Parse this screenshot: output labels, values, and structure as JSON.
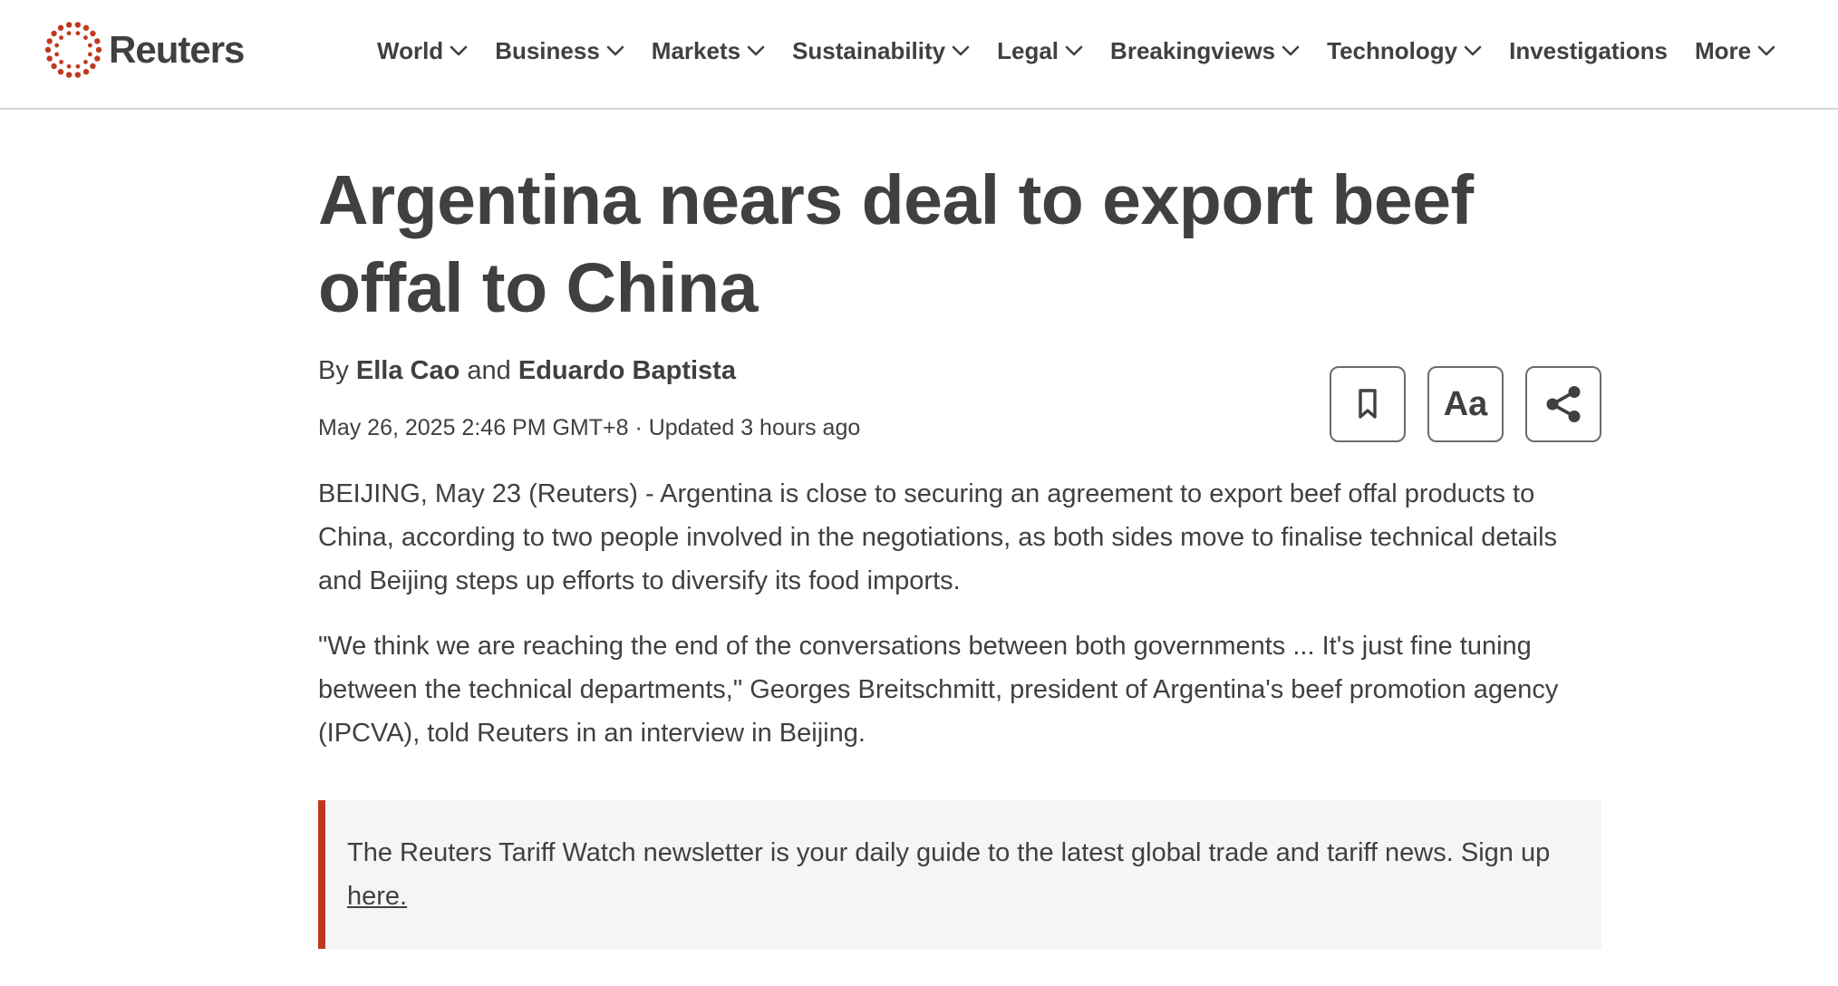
{
  "brand": {
    "name": "Reuters",
    "logo_icon": "reuters-dot-ring-icon",
    "accent_color": "#c0391e"
  },
  "nav": {
    "items": [
      {
        "label": "World",
        "has_dropdown": true
      },
      {
        "label": "Business",
        "has_dropdown": true
      },
      {
        "label": "Markets",
        "has_dropdown": true
      },
      {
        "label": "Sustainability",
        "has_dropdown": true
      },
      {
        "label": "Legal",
        "has_dropdown": true
      },
      {
        "label": "Breakingviews",
        "has_dropdown": true
      },
      {
        "label": "Technology",
        "has_dropdown": true
      },
      {
        "label": "Investigations",
        "has_dropdown": false
      },
      {
        "label": "More",
        "has_dropdown": true
      }
    ]
  },
  "article": {
    "headline": "Argentina nears deal to export beef offal to China",
    "byline": {
      "prefix": "By",
      "author1": "Ella Cao",
      "conjunction": "and",
      "author2": "Eduardo Baptista"
    },
    "dateline": "May 26, 2025 2:46 PM GMT+8 · Updated 3 hours ago",
    "tools": {
      "bookmark_icon": "bookmark-icon",
      "text_size_label": "Aa",
      "share_icon": "share-icon"
    },
    "paragraphs": [
      "BEIJING, May 23 (Reuters) - Argentina is close to securing an agreement to export beef offal products to China, according to two people involved in the negotiations, as both sides move to finalise technical details and Beijing steps up efforts to diversify its food imports.",
      "\"We think we are reaching the end of the conversations between both governments ... It's just fine tuning between the technical departments,\" Georges Breitschmitt, president of Argentina's beef promotion agency (IPCVA), told Reuters in an interview in Beijing."
    ],
    "newsletter": {
      "text": "The Reuters Tariff Watch newsletter is your daily guide to the latest global trade and tariff news. Sign up ",
      "link_label": "here."
    }
  }
}
